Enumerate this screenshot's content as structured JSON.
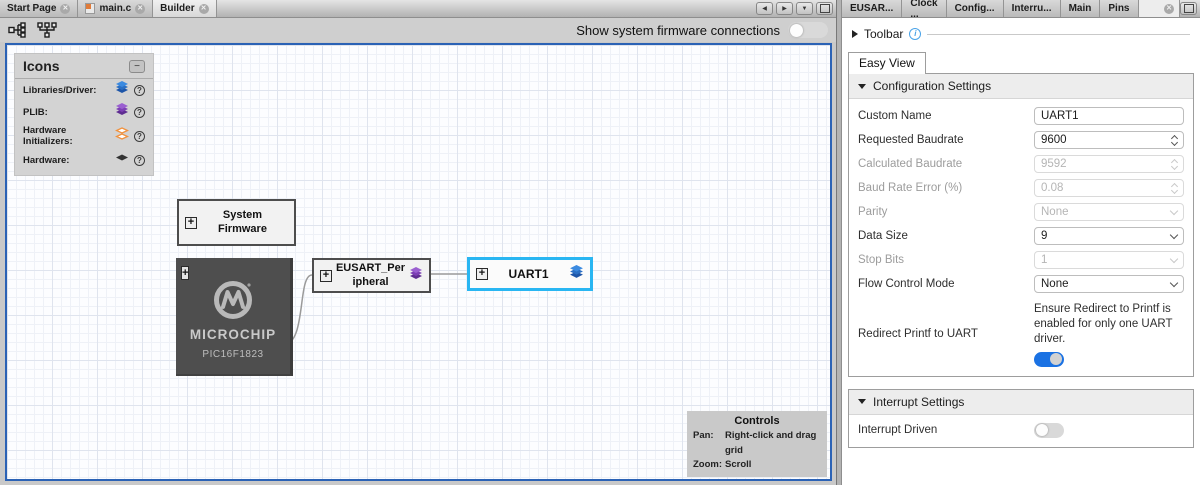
{
  "colors": {
    "selection_highlight": "#29b6f2",
    "toggle_on": "#1b72e3",
    "canvas_border": "#2b62b5",
    "legend_blue": "#2d7fd3",
    "legend_purple": "#8a4fc0",
    "legend_orange": "#f0923f",
    "legend_black": "#333333",
    "info_icon": "#4aa3e8"
  },
  "editor": {
    "tabs": [
      {
        "label": "Start Page"
      },
      {
        "label": "main.c"
      },
      {
        "label": "Builder"
      }
    ],
    "show_connections_label": "Show system firmware connections"
  },
  "canvas": {
    "legend": {
      "title": "Icons",
      "items": [
        {
          "label": "Libraries/Driver:",
          "icon": "layers-blue"
        },
        {
          "label": "PLIB:",
          "icon": "layers-purple"
        },
        {
          "label": "Hardware Initializers:",
          "icon": "layers-orange"
        },
        {
          "label": "Hardware:",
          "icon": "diamond-black"
        }
      ]
    },
    "blocks": {
      "system_firmware": {
        "label": "System Firmware"
      },
      "chip": {
        "brand": "MICROCHIP",
        "part": "PIC16F1823"
      },
      "eusart": {
        "label": "EUSART_Peripheral",
        "icon": "layers-purple"
      },
      "uart1": {
        "label": "UART1",
        "icon": "layers-blue",
        "selected": true
      }
    },
    "controls": {
      "title": "Controls",
      "rows": [
        {
          "key": "Pan:",
          "value": "Right-click and drag grid"
        },
        {
          "key": "Zoom:",
          "value": "Scroll"
        }
      ]
    }
  },
  "inspector": {
    "tabs": [
      {
        "label": "EUSAR..."
      },
      {
        "label": "Clock ..."
      },
      {
        "label": "Config..."
      },
      {
        "label": "Interru..."
      },
      {
        "label": "Main"
      },
      {
        "label": "Pins"
      }
    ],
    "toolbar_label": "Toolbar",
    "easy_view_label": "Easy View",
    "config": {
      "title": "Configuration Settings",
      "rows": [
        {
          "label": "Custom Name",
          "value": "UART1",
          "control": "text",
          "enabled": true
        },
        {
          "label": "Requested Baudrate",
          "value": "9600",
          "control": "spinner",
          "enabled": true
        },
        {
          "label": "Calculated Baudrate",
          "value": "9592",
          "control": "spinner",
          "enabled": false
        },
        {
          "label": "Baud Rate Error (%)",
          "value": "0.08",
          "control": "spinner",
          "enabled": false
        },
        {
          "label": "Parity",
          "value": "None",
          "control": "select",
          "enabled": false
        },
        {
          "label": "Data Size",
          "value": "9",
          "control": "select",
          "enabled": true
        },
        {
          "label": "Stop Bits",
          "value": "1",
          "control": "select",
          "enabled": false
        },
        {
          "label": "Flow Control Mode",
          "value": "None",
          "control": "select",
          "enabled": true
        },
        {
          "label": "Redirect Printf to UART",
          "control": "toggle",
          "state": "on",
          "note": "Ensure Redirect to Printf is enabled for only one UART driver."
        }
      ]
    },
    "interrupts": {
      "title": "Interrupt Settings",
      "rows": [
        {
          "label": "Interrupt Driven",
          "control": "toggle",
          "state": "off"
        }
      ]
    }
  }
}
